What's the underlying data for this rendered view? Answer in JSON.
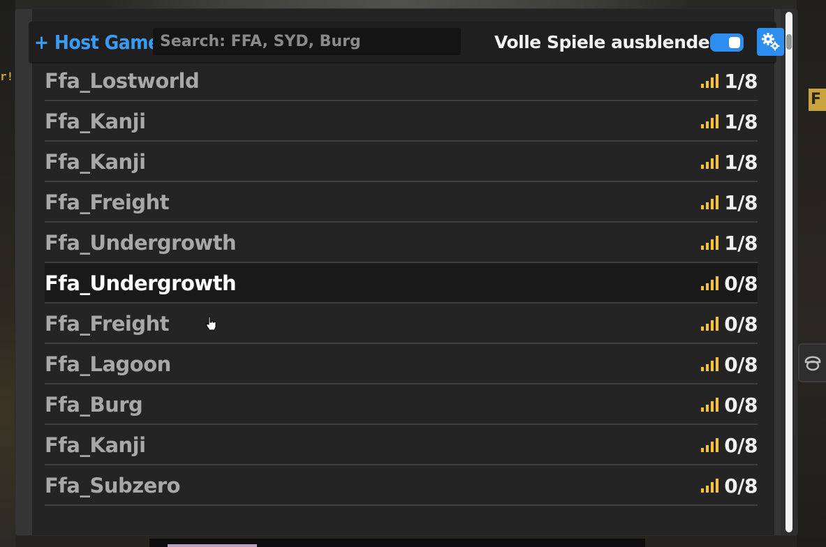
{
  "header": {
    "host_label": "+ Host Game",
    "search_placeholder": "Search: FFA, SYD, Burg",
    "hide_full_label": "Volle Spiele ausblenden",
    "hide_full_enabled": true
  },
  "background": {
    "left_text": "r!",
    "right_sign": "F"
  },
  "colors": {
    "accent": "#2d8ef0",
    "host_text": "#3a9bf2",
    "signal": "#f5c333",
    "row_text": "#a8a8a8"
  },
  "rows": [
    {
      "name": "Ffa_Lostworld",
      "players": "1/8"
    },
    {
      "name": "Ffa_Kanji",
      "players": "1/8"
    },
    {
      "name": "Ffa_Kanji",
      "players": "1/8"
    },
    {
      "name": "Ffa_Freight",
      "players": "1/8"
    },
    {
      "name": "Ffa_Undergrowth",
      "players": "1/8"
    },
    {
      "name": "Ffa_Undergrowth",
      "players": "0/8",
      "hover": true
    },
    {
      "name": "Ffa_Freight",
      "players": "0/8"
    },
    {
      "name": "Ffa_Lagoon",
      "players": "0/8"
    },
    {
      "name": "Ffa_Burg",
      "players": "0/8"
    },
    {
      "name": "Ffa_Kanji",
      "players": "0/8"
    },
    {
      "name": "Ffa_Subzero",
      "players": "0/8"
    }
  ]
}
